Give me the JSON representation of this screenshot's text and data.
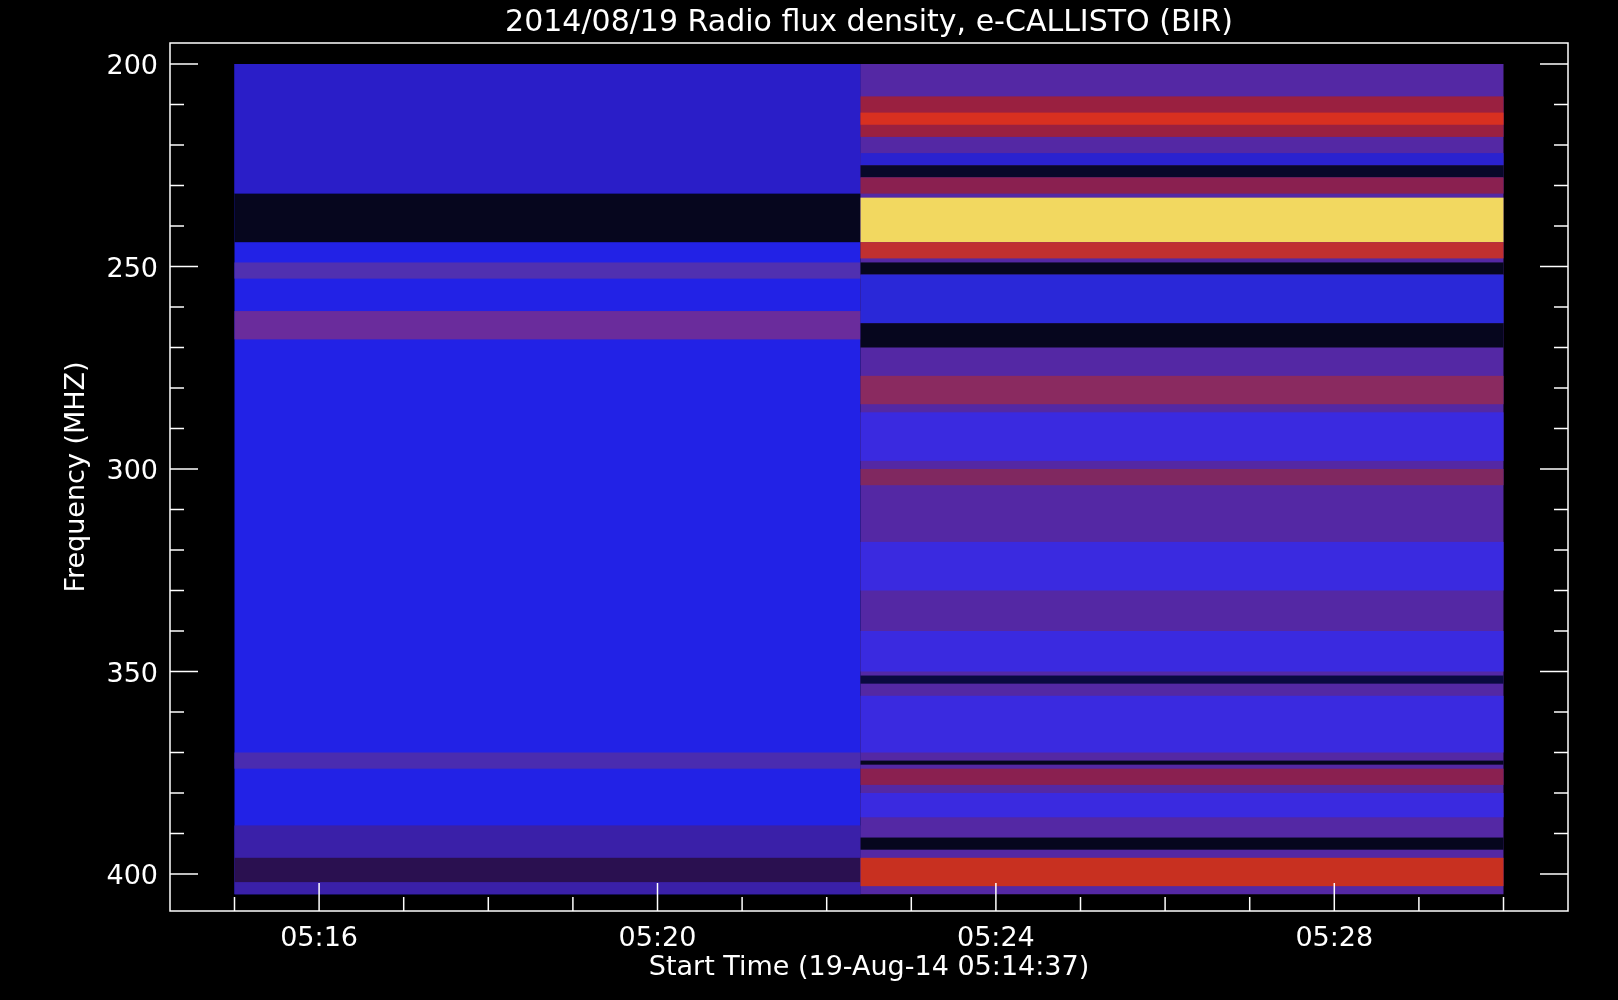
{
  "title": "2014/08/19  Radio flux density, e-CALLISTO (BIR)",
  "y_axis": {
    "label": "Frequency (MHZ)",
    "ticks": [
      "200",
      "250",
      "300",
      "350",
      "400"
    ]
  },
  "x_axis": {
    "label": "Start Time (19-Aug-14 05:14:37)",
    "ticks": [
      "05:16",
      "05:20",
      "05:24",
      "05:28"
    ]
  }
}
